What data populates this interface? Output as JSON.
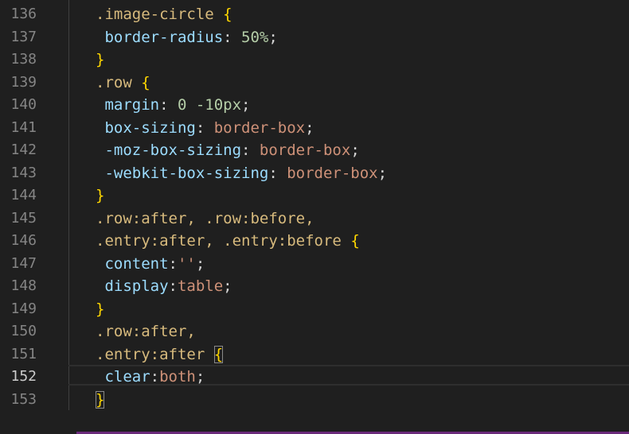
{
  "line_numbers": [
    "136",
    "137",
    "138",
    "139",
    "140",
    "141",
    "142",
    "143",
    "144",
    "145",
    "146",
    "147",
    "148",
    "149",
    "150",
    "151",
    "152",
    "153"
  ],
  "active_line": "152",
  "lines": [
    {
      "segs": [
        {
          "t": ".image-circle",
          "c": "sel"
        },
        {
          "t": " ",
          "c": "punc"
        },
        {
          "t": "{",
          "c": "brace"
        }
      ]
    },
    {
      "segs": [
        {
          "t": " border-radius",
          "c": "prop"
        },
        {
          "t": ": ",
          "c": "punc"
        },
        {
          "t": "50%",
          "c": "num"
        },
        {
          "t": ";",
          "c": "punc"
        }
      ]
    },
    {
      "segs": [
        {
          "t": "}",
          "c": "brace"
        }
      ]
    },
    {
      "segs": [
        {
          "t": ".row",
          "c": "sel"
        },
        {
          "t": " ",
          "c": "punc"
        },
        {
          "t": "{",
          "c": "brace"
        }
      ]
    },
    {
      "segs": [
        {
          "t": " margin",
          "c": "prop"
        },
        {
          "t": ": ",
          "c": "punc"
        },
        {
          "t": "0 -10px",
          "c": "num"
        },
        {
          "t": ";",
          "c": "punc"
        }
      ]
    },
    {
      "segs": [
        {
          "t": " box-sizing",
          "c": "prop"
        },
        {
          "t": ": ",
          "c": "punc"
        },
        {
          "t": "border-box",
          "c": "val"
        },
        {
          "t": ";",
          "c": "punc"
        }
      ]
    },
    {
      "segs": [
        {
          "t": " -moz-box-sizing",
          "c": "prop"
        },
        {
          "t": ": ",
          "c": "punc"
        },
        {
          "t": "border-box",
          "c": "val"
        },
        {
          "t": ";",
          "c": "punc"
        }
      ]
    },
    {
      "segs": [
        {
          "t": " -webkit-box-sizing",
          "c": "prop"
        },
        {
          "t": ": ",
          "c": "punc"
        },
        {
          "t": "border-box",
          "c": "val"
        },
        {
          "t": ";",
          "c": "punc"
        }
      ]
    },
    {
      "segs": [
        {
          "t": "}",
          "c": "brace"
        }
      ]
    },
    {
      "segs": [
        {
          "t": ".row:after, .row:before,",
          "c": "sel"
        }
      ]
    },
    {
      "segs": [
        {
          "t": ".entry:after, .entry:before",
          "c": "sel"
        },
        {
          "t": " ",
          "c": "punc"
        },
        {
          "t": "{",
          "c": "brace"
        }
      ]
    },
    {
      "segs": [
        {
          "t": " content",
          "c": "prop"
        },
        {
          "t": ":",
          "c": "punc"
        },
        {
          "t": "''",
          "c": "str"
        },
        {
          "t": ";",
          "c": "punc"
        }
      ]
    },
    {
      "segs": [
        {
          "t": " display",
          "c": "prop"
        },
        {
          "t": ":",
          "c": "punc"
        },
        {
          "t": "table",
          "c": "val"
        },
        {
          "t": ";",
          "c": "punc"
        }
      ]
    },
    {
      "segs": [
        {
          "t": "}",
          "c": "brace"
        }
      ]
    },
    {
      "segs": [
        {
          "t": ".row:after,",
          "c": "sel"
        }
      ]
    },
    {
      "segs": [
        {
          "t": ".entry:after",
          "c": "sel"
        },
        {
          "t": " ",
          "c": "punc"
        },
        {
          "t": "{",
          "c": "brace match"
        }
      ]
    },
    {
      "segs": [
        {
          "t": " clear",
          "c": "prop"
        },
        {
          "t": ":",
          "c": "punc"
        },
        {
          "t": "both",
          "c": "val"
        },
        {
          "t": ";",
          "c": "punc"
        }
      ]
    },
    {
      "segs": [
        {
          "t": "}",
          "c": "brace match"
        }
      ]
    }
  ],
  "colors": {
    "background": "#1f1f1f",
    "selector": "#d7ba7d",
    "brace": "#ffd700",
    "property": "#9cdcfe",
    "number": "#b5cea8",
    "value": "#ce9178"
  }
}
